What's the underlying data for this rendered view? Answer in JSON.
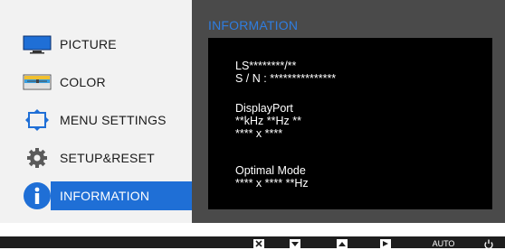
{
  "menu": {
    "items": [
      {
        "label": "PICTURE",
        "icon": "monitor-icon"
      },
      {
        "label": "COLOR",
        "icon": "color-icon"
      },
      {
        "label": "MENU SETTINGS",
        "icon": "menu-settings-icon"
      },
      {
        "label": "SETUP&RESET",
        "icon": "gear-icon"
      },
      {
        "label": "INFORMATION",
        "icon": "info-icon"
      }
    ],
    "selected": "INFORMATION"
  },
  "panel": {
    "title": "INFORMATION",
    "lines": [
      "LS********/**",
      "S / N : ***************",
      "DisplayPort",
      "**kHz **Hz **",
      "**** x ****",
      "Optimal Mode",
      "**** x **** **Hz"
    ]
  },
  "bottom_bar": {
    "buttons": [
      {
        "icon": "close-icon"
      },
      {
        "icon": "down-arrow-icon"
      },
      {
        "icon": "up-arrow-icon"
      },
      {
        "icon": "right-arrow-icon"
      },
      {
        "label": "AUTO",
        "icon": "auto-label"
      },
      {
        "icon": "power-icon"
      }
    ]
  },
  "colors": {
    "accent": "#1f6fd6",
    "title_blue": "#2f7de0",
    "osd_dark": "#4a4a4a",
    "left_bg": "#f2f2f2"
  }
}
